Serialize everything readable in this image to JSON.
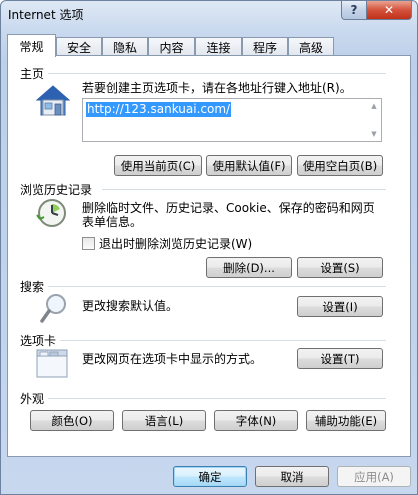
{
  "window": {
    "title": "Internet 选项",
    "help_glyph": "?",
    "close_glyph": "✕"
  },
  "tabs": [
    "常规",
    "安全",
    "隐私",
    "内容",
    "连接",
    "程序",
    "高级"
  ],
  "home": {
    "title": "主页",
    "instruction": "若要创建主页选项卡，请在各地址行键入地址(R)。",
    "url": "http://123.sankuai.com/",
    "buttons": [
      "使用当前页(C)",
      "使用默认值(F)",
      "使用空白页(B)"
    ]
  },
  "history": {
    "title": "浏览历史记录",
    "description_line1": "删除临时文件、历史记录、Cookie、保存的密码和网页",
    "description_line2": "表单信息。",
    "checkbox_label": "退出时删除浏览历史记录(W)",
    "delete_button": "删除(D)...",
    "settings_button": "设置(S)"
  },
  "search": {
    "title": "搜索",
    "description": "更改搜索默认值。",
    "settings_button": "设置(I)"
  },
  "tabs_section": {
    "title": "选项卡",
    "description": "更改网页在选项卡中显示的方式。",
    "settings_button": "设置(T)"
  },
  "appearance": {
    "title": "外观",
    "buttons": [
      "颜色(O)",
      "语言(L)",
      "字体(N)",
      "辅助功能(E)"
    ]
  },
  "footer": {
    "ok": "确定",
    "cancel": "取消",
    "apply": "应用(A)"
  }
}
